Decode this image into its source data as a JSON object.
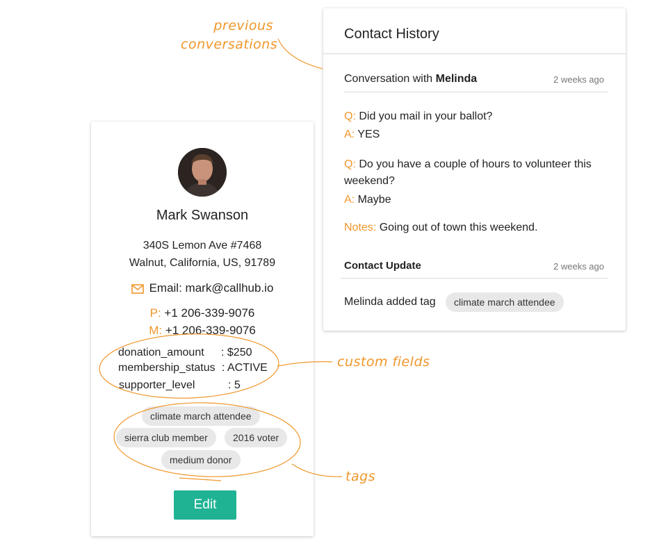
{
  "annotations": {
    "previous_line1": "previous",
    "previous_line2": "conversations",
    "custom_fields": "custom fields",
    "tags": "tags"
  },
  "contact": {
    "name": "Mark Swanson",
    "address_line1": "340S Lemon Ave #7468",
    "address_line2": "Walnut, California, US, 91789",
    "email_label": "Email:",
    "email": "mark@callhub.io",
    "phone_label": "P:",
    "phone": "+1 206-339-9076",
    "mobile_label": "M:",
    "mobile": "+1 206-339-9076",
    "custom_fields": [
      {
        "key": "donation_amount",
        "value": ": $250"
      },
      {
        "key": "membership_status",
        "value": ": ACTIVE"
      },
      {
        "key": "supporter_level",
        "value": ": 5"
      }
    ],
    "tags": [
      "climate march attendee",
      "sierra club member",
      "2016 voter",
      "medium donor"
    ],
    "edit_label": "Edit",
    "icons": {
      "email": "mail-icon",
      "avatar": "profile-photo"
    }
  },
  "history": {
    "title": "Contact History",
    "conversation": {
      "prefix": "Conversation with",
      "with": "Melinda",
      "time": "2 weeks ago",
      "q_label": "Q:",
      "a_label": "A:",
      "items": [
        {
          "q": "Did you mail in your ballot?",
          "a": "YES"
        },
        {
          "q": "Do you have a couple of hours to volunteer this weekend?",
          "a": "Maybe"
        }
      ],
      "notes_label": "Notes:",
      "notes": "Going out of town this weekend."
    },
    "update": {
      "title": "Contact Update",
      "time": "2 weeks ago",
      "text": "Melinda added tag",
      "tag": "climate march attendee"
    }
  },
  "colors": {
    "accent": "#f0962a",
    "button": "#1fb394",
    "tag_bg": "#e8e8e8"
  }
}
